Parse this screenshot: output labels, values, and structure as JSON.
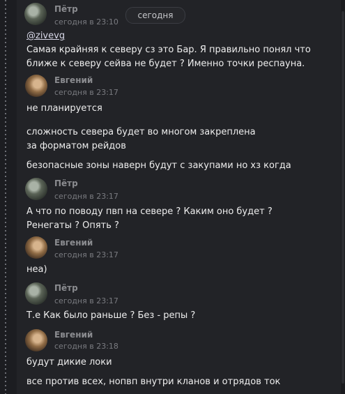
{
  "date_divider": "сегодня",
  "messages": [
    {
      "author": "Пётр",
      "time": "сегодня в 23:10",
      "avatar": "petr",
      "lines": [
        "@zivevg",
        "Самая крайняя к северу сз это Бар. Я правильно понял что ближе к северу сейва не будет ? Именно точки респауна."
      ]
    },
    {
      "author": "Евгений",
      "time": "сегодня в 23:17",
      "avatar": "evg",
      "lines": [
        "не планируется",
        "сложность севера будет во многом закреплена за форматом рейдов",
        "безопасные зоны наверн будут с закупами но хз когда"
      ]
    },
    {
      "author": "Пётр",
      "time": "сегодня в 23:17",
      "avatar": "petr",
      "lines": [
        "А что по поводу пвп на севере ? Каким оно будет ? Ренегаты ? Опять ?"
      ]
    },
    {
      "author": "Евгений",
      "time": "сегодня в 23:17",
      "avatar": "evg",
      "lines": [
        "неа)"
      ]
    },
    {
      "author": "Пётр",
      "time": "сегодня в 23:17",
      "avatar": "petr",
      "lines": [
        "Т.е Как было раньше ? Без - репы ?"
      ]
    },
    {
      "author": "Евгений",
      "time": "сегодня в 23:18",
      "avatar": "evg",
      "lines": [
        "будут дикие локи",
        "все против всех, нопвп внутри кланов и отрядов ток"
      ]
    }
  ]
}
